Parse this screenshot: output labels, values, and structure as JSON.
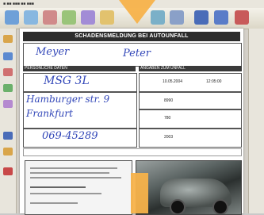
{
  "form": {
    "title": "SCHADENSMELDUNG BEI AUTOUNFALL",
    "section1": "PERSÖNLICHE DATEN",
    "section2": "ANGABEN ZUM UNFALL"
  },
  "handwritten": {
    "last_name": "Meyer",
    "first_name": "Peter",
    "plate": "MSG 3L",
    "street": "Hamburger str. 9",
    "city": "Frankfurt",
    "phone": "069-45289"
  },
  "typed": {
    "date": "10.05.2004",
    "time": "12:05:00",
    "amount": "8990",
    "km": "780",
    "year": "2003"
  },
  "colors": {
    "accent": "#f7b24a",
    "ink": "#3146b8"
  }
}
